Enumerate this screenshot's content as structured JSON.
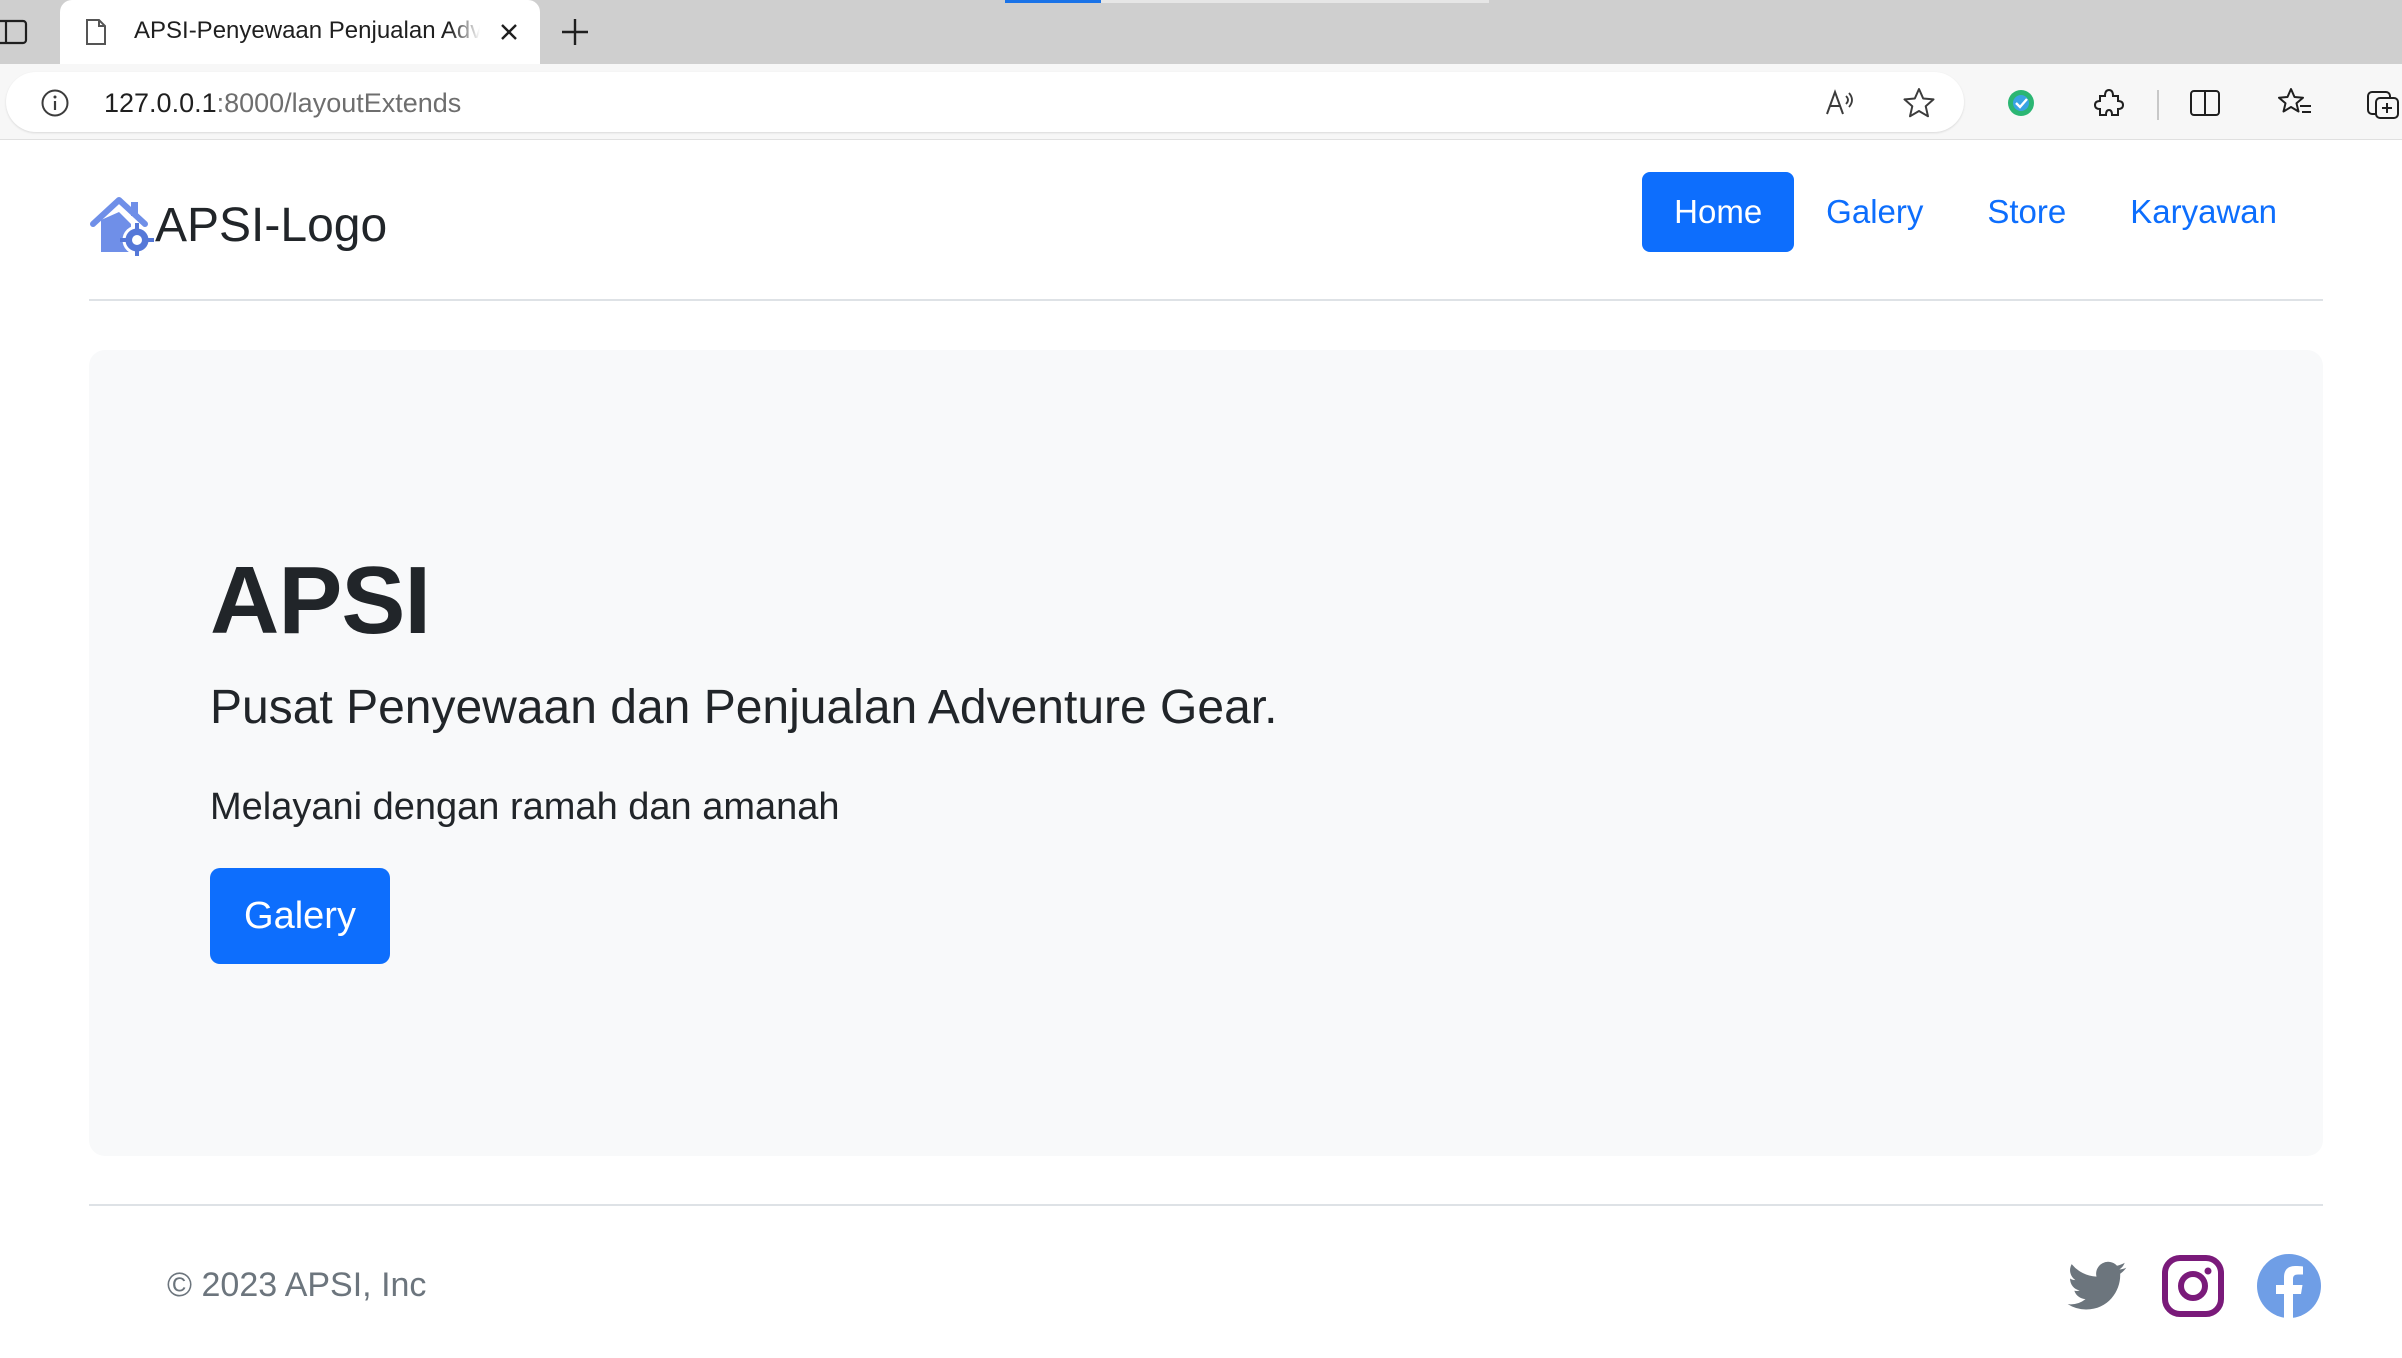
{
  "browser": {
    "tab_title": "APSI-Penyewaan Penjualan Adventure Gear",
    "url_host": "127.0.0.1",
    "url_rest": ":8000/layoutExtends"
  },
  "navbar": {
    "brand": "APSI-Logo",
    "links": [
      {
        "label": "Home",
        "active": true
      },
      {
        "label": "Galery",
        "active": false
      },
      {
        "label": "Store",
        "active": false
      },
      {
        "label": "Karyawan",
        "active": false
      }
    ]
  },
  "hero": {
    "title": "APSI",
    "subtitle": "Pusat Penyewaan dan Penjualan Adventure Gear.",
    "text": "Melayani dengan ramah dan amanah",
    "button": "Galery"
  },
  "footer": {
    "copyright": "© 2023 APSI, Inc",
    "social": [
      "twitter-icon",
      "instagram-icon",
      "facebook-icon"
    ]
  },
  "colors": {
    "primary": "#0d6efd",
    "hero_bg": "#f8f9fa",
    "twitter": "#6c757d",
    "instagram": "#7a1a7a",
    "facebook": "#6f9ee6"
  }
}
